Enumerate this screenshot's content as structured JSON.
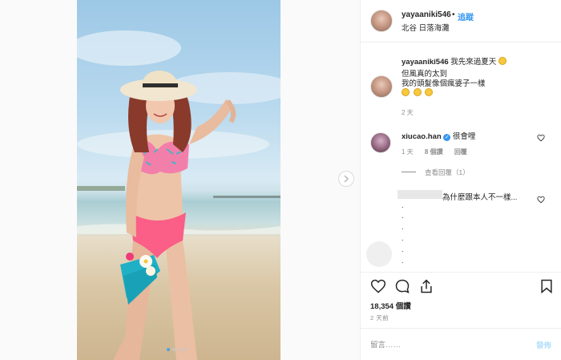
{
  "post": {
    "username": "yayaaniki546",
    "separator": "•",
    "follow_label": "追蹤",
    "location": "北谷 日落海灘"
  },
  "caption": {
    "username": "yayaaniki546",
    "line1": "我先來過夏天",
    "line2": "但風真的太到",
    "line3": "我的頭髮像個瘋婆子一樣",
    "age": "2 天"
  },
  "comment": {
    "username": "xiucao.han",
    "text": "很會哩",
    "age": "1 天",
    "likes": "8 個讚",
    "reply_label": "回覆",
    "view_replies_label": "查看回覆（1）"
  },
  "reply": {
    "text": "為什麼跟本人不一樣...",
    "dots": [
      ".",
      ".",
      ".",
      ".",
      ".",
      "."
    ]
  },
  "stats": {
    "likes": "18,354 個讚",
    "timestamp": "2 天前"
  },
  "composer": {
    "placeholder": "留言……",
    "post_label": "發佈"
  },
  "icons": {
    "like": "heart-icon",
    "comment": "comment-bubble-icon",
    "share": "share-icon",
    "save": "bookmark-icon",
    "next": "chevron-right-icon",
    "verified": "verified-badge-icon"
  },
  "colors": {
    "accent": "#3897f0",
    "post_disabled": "#b2dffc",
    "muted": "#8e8e8e"
  }
}
